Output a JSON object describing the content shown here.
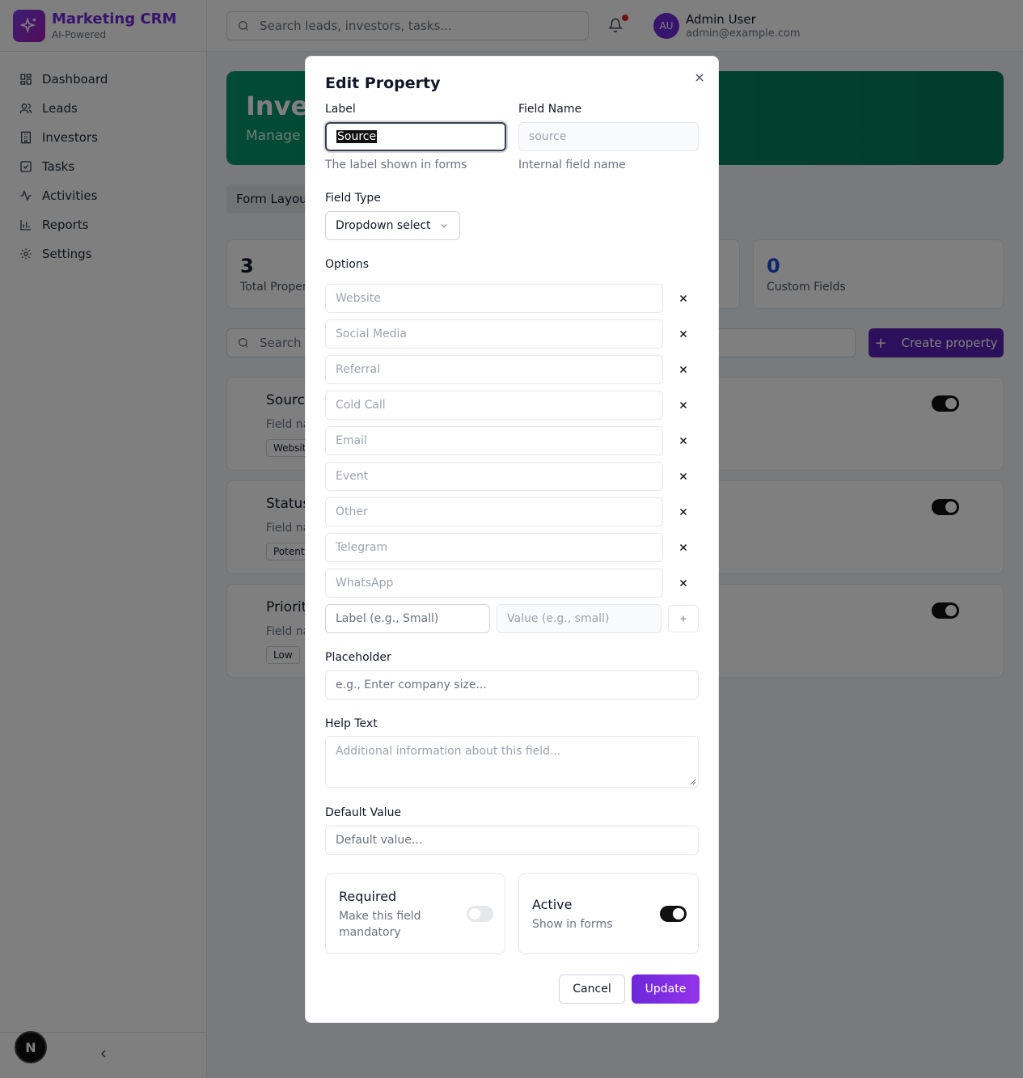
{
  "app": {
    "name": "Marketing CRM",
    "tagline": "AI-Powered",
    "accent": "#6d28d9"
  },
  "sidebar": {
    "items": [
      {
        "label": "Dashboard",
        "icon": "dashboard-icon"
      },
      {
        "label": "Leads",
        "icon": "users-icon"
      },
      {
        "label": "Investors",
        "icon": "building-icon"
      },
      {
        "label": "Tasks",
        "icon": "checkbox-icon"
      },
      {
        "label": "Activities",
        "icon": "activity-icon"
      },
      {
        "label": "Reports",
        "icon": "bar-chart-icon"
      },
      {
        "label": "Settings",
        "icon": "gear-icon"
      }
    ],
    "footer_badge": "N"
  },
  "topbar": {
    "search_placeholder": "Search leads, investors, tasks...",
    "user": {
      "initials": "AU",
      "name": "Admin User",
      "email": "admin@example.com"
    }
  },
  "page": {
    "hero_title": "Inve",
    "hero_sub": "Manage c",
    "tab": "Form Layout",
    "stats": [
      {
        "value": "3",
        "label": "Total Proper"
      },
      {
        "value": "0",
        "label": "Custom Fields"
      }
    ],
    "search_placeholder": "Search p",
    "create_label": "Create property",
    "properties": [
      {
        "title": "Source",
        "field": "Field na",
        "chip": "Websit"
      },
      {
        "title": "Status",
        "field": "Field na",
        "chip": "Potent"
      },
      {
        "title": "Priorit",
        "field": "Field na",
        "chip": "Low"
      }
    ]
  },
  "modal": {
    "title": "Edit Property",
    "label": {
      "title": "Label",
      "value": "Source",
      "help": "The label shown in forms"
    },
    "field_name": {
      "title": "Field Name",
      "value": "source",
      "help": "Internal field name"
    },
    "field_type": {
      "title": "Field Type",
      "value": "Dropdown select"
    },
    "options": {
      "title": "Options",
      "items": [
        "Website",
        "Social Media",
        "Referral",
        "Cold Call",
        "Email",
        "Event",
        "Other",
        "Telegram",
        "WhatsApp"
      ],
      "new_label_placeholder": "Label (e.g., Small)",
      "new_value_placeholder": "Value (e.g., small)"
    },
    "placeholder": {
      "title": "Placeholder",
      "placeholder": "e.g., Enter company size..."
    },
    "help_text": {
      "title": "Help Text",
      "placeholder": "Additional information about this field..."
    },
    "default_value": {
      "title": "Default Value",
      "placeholder": "Default value..."
    },
    "required": {
      "title": "Required",
      "desc_line1": "Make this field",
      "desc_line2": "mandatory",
      "on": false
    },
    "active": {
      "title": "Active",
      "desc": "Show in forms",
      "on": true
    },
    "cancel_label": "Cancel",
    "update_label": "Update"
  }
}
